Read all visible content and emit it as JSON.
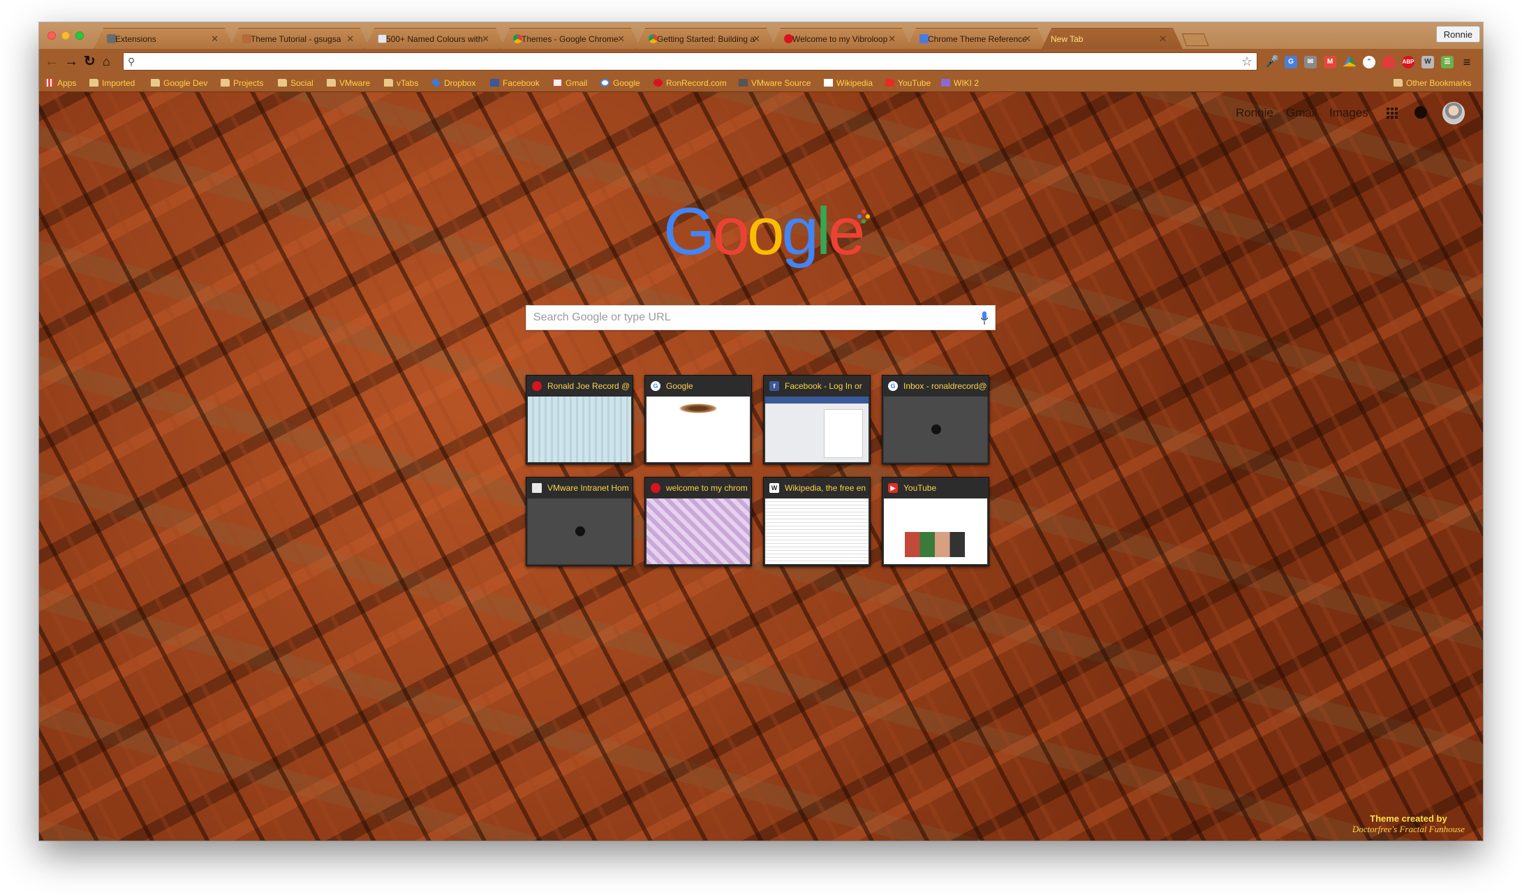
{
  "window": {
    "profile_label": "Ronnie"
  },
  "tabs": [
    {
      "label": "Extensions",
      "icon": "puzzle-icon",
      "active": false
    },
    {
      "label": "Theme Tutorial - gsugsa",
      "icon": "image-icon",
      "active": false
    },
    {
      "label": "500+ Named Colours with",
      "icon": "document-icon",
      "active": false
    },
    {
      "label": "Themes - Google Chrome",
      "icon": "chrome-icon",
      "active": false
    },
    {
      "label": "Getting Started: Building a",
      "icon": "chrome-icon",
      "active": false
    },
    {
      "label": "Welcome to my Vibroloop",
      "icon": "record-icon",
      "active": false
    },
    {
      "label": "Chrome Theme Reference",
      "icon": "document-icon",
      "active": false
    },
    {
      "label": "New Tab",
      "icon": "none",
      "active": true
    }
  ],
  "toolbar": {
    "address_value": "",
    "extensions": [
      "microphone-icon",
      "translate-icon",
      "mail-icon",
      "gmail-icon",
      "drive-icon",
      "hangouts-icon",
      "lastpass-icon",
      "adblock-icon",
      "w-icon",
      "evernote-icon",
      "menu-icon"
    ]
  },
  "bookmarks": [
    {
      "label": "Apps",
      "icon": "apps-icon"
    },
    {
      "label": "Imported",
      "icon": "folder-icon"
    },
    {
      "label": "Google Dev",
      "icon": "folder-icon"
    },
    {
      "label": "Projects",
      "icon": "folder-icon"
    },
    {
      "label": "Social",
      "icon": "folder-icon"
    },
    {
      "label": "VMware",
      "icon": "folder-icon"
    },
    {
      "label": "vTabs",
      "icon": "folder-icon"
    },
    {
      "label": "Dropbox",
      "icon": "dropbox-icon"
    },
    {
      "label": "Facebook",
      "icon": "facebook-icon"
    },
    {
      "label": "Gmail",
      "icon": "gmail-icon"
    },
    {
      "label": "Google",
      "icon": "google-icon"
    },
    {
      "label": "RonRecord.com",
      "icon": "record-icon"
    },
    {
      "label": "VMware Source",
      "icon": "vmware-icon"
    },
    {
      "label": "Wikipedia",
      "icon": "wikipedia-icon"
    },
    {
      "label": "YouTube",
      "icon": "youtube-icon"
    },
    {
      "label": "WIKI 2",
      "icon": "w-icon"
    }
  ],
  "other_bookmarks": "Other Bookmarks",
  "header_links": {
    "user": "Ronnie",
    "gmail": "Gmail",
    "images": "Images"
  },
  "logo_text": "Google",
  "search": {
    "placeholder": "Search Google or type URL",
    "value": ""
  },
  "tiles": [
    {
      "title": "Ronald Joe Record @",
      "icon": "record-icon",
      "thumb": "ronrecord"
    },
    {
      "title": "Google",
      "icon": "google-icon",
      "thumb": "google"
    },
    {
      "title": "Facebook - Log In or",
      "icon": "facebook-icon",
      "thumb": "facebook"
    },
    {
      "title": "Inbox - ronaldrecord@",
      "icon": "google-icon",
      "thumb": "blank"
    },
    {
      "title": "VMware Intranet Hom",
      "icon": "document-icon",
      "thumb": "blank"
    },
    {
      "title": "welcome to my chrom",
      "icon": "record-icon",
      "thumb": "pattern"
    },
    {
      "title": "Wikipedia, the free en",
      "icon": "wikipedia-icon",
      "thumb": "wikipedia"
    },
    {
      "title": "YouTube",
      "icon": "youtube-icon",
      "thumb": "youtube"
    }
  ],
  "credit": {
    "line1": "Theme created by",
    "line2": "Doctorfree's Fractal Funhouse"
  },
  "colors": {
    "accent_text": "#ffd34a",
    "frame": "#a15d2c",
    "tab_bg": "#c48a52"
  }
}
